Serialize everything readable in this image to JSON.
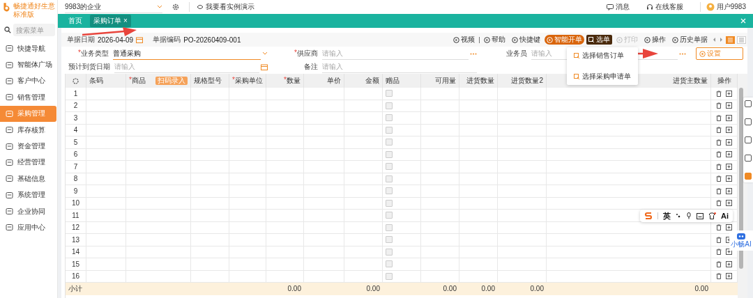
{
  "sidebar": {
    "brand": "畅捷通好生意",
    "edition": "标准版",
    "search_placeholder": "搜索菜单",
    "items": [
      {
        "label": "快捷导航",
        "selected": false
      },
      {
        "label": "智能体广场",
        "selected": false
      },
      {
        "label": "客户中心",
        "selected": false
      },
      {
        "label": "销售管理",
        "selected": false
      },
      {
        "label": "采购管理",
        "selected": true
      },
      {
        "label": "库存核算",
        "selected": false
      },
      {
        "label": "资金管理",
        "selected": false
      },
      {
        "label": "经营管理",
        "selected": false
      },
      {
        "label": "基础信息",
        "selected": false
      },
      {
        "label": "系统管理",
        "selected": false
      },
      {
        "label": "企业协同",
        "selected": false
      },
      {
        "label": "应用中心",
        "selected": false
      }
    ]
  },
  "top_bar": {
    "company": "9983的企业",
    "demo_link": "我要看实例演示",
    "messages": "消息",
    "support": "在线客服",
    "user": "用户9983"
  },
  "tabs": [
    {
      "label": "首页",
      "selected": false
    },
    {
      "label": "采购订单",
      "selected": true,
      "close": "×"
    }
  ],
  "document": {
    "date_label": "单据日期",
    "date": "2026-04-09",
    "code_label": "单据编码",
    "code": "PO-20260409-001"
  },
  "toolbar": [
    {
      "label": "视频",
      "kind": "link",
      "disabled": false
    },
    {
      "label": "帮助",
      "kind": "link",
      "disabled": false
    },
    {
      "label": "快捷键",
      "kind": "link",
      "disabled": false
    },
    {
      "label": "智能开单",
      "kind": "primary",
      "disabled": false
    },
    {
      "label": "选单",
      "kind": "menu",
      "disabled": false
    },
    {
      "label": "打印",
      "kind": "link",
      "disabled": true
    },
    {
      "label": "操作",
      "kind": "link",
      "disabled": false
    },
    {
      "label": "历史单据",
      "kind": "link",
      "disabled": false
    }
  ],
  "select_menu": [
    "选择销售订单",
    "选择采购申请单"
  ],
  "form": {
    "fields": [
      {
        "label": "业务类型",
        "required": true,
        "value": "普通采购",
        "kind": "select"
      },
      {
        "label": "供应商",
        "required": true,
        "placeholder": "请输入",
        "kind": "lookup"
      },
      {
        "label": "业务员",
        "required": false,
        "placeholder": "请输入",
        "kind": "lookup"
      },
      {
        "label": "预计到货日期",
        "required": false,
        "placeholder": "请输入",
        "kind": "date"
      },
      {
        "label": "备注",
        "required": false,
        "placeholder": "请输入",
        "kind": "text"
      }
    ],
    "settings_button": "设置"
  },
  "required_mark": "*",
  "table": {
    "columns": [
      {
        "label": "条码",
        "kind": "text",
        "required": false
      },
      {
        "label": "商品",
        "kind": "text",
        "required": true,
        "badge": "扫码录入"
      },
      {
        "label": "规格型号",
        "kind": "text",
        "required": false
      },
      {
        "label": "采购单位",
        "kind": "text",
        "required": true
      },
      {
        "label": "数量",
        "kind": "number",
        "required": true,
        "total": "0.00"
      },
      {
        "label": "单价",
        "kind": "number",
        "required": false
      },
      {
        "label": "金额",
        "kind": "number",
        "required": false,
        "total": "0.00"
      },
      {
        "label": "赠品",
        "kind": "checkbox",
        "required": false
      },
      {
        "label": "可用量",
        "kind": "number",
        "required": false,
        "total": "0.00"
      },
      {
        "label": "进货数量",
        "kind": "number",
        "required": false,
        "total": "0.00"
      },
      {
        "label": "进货数量2",
        "kind": "number",
        "required": false,
        "total": "0.00"
      },
      {
        "label": "进货主数量",
        "kind": "number",
        "required": false,
        "total": "0.00"
      },
      {
        "label": "操作",
        "kind": "actions",
        "required": false
      }
    ],
    "rows": [
      {
        "no": "1",
        "gift_checked": false
      },
      {
        "no": "2",
        "gift_checked": false
      },
      {
        "no": "3",
        "gift_checked": false
      },
      {
        "no": "4",
        "gift_checked": false
      },
      {
        "no": "5",
        "gift_checked": false
      },
      {
        "no": "6",
        "gift_checked": false
      },
      {
        "no": "7",
        "gift_checked": false
      },
      {
        "no": "8",
        "gift_checked": false
      },
      {
        "no": "9",
        "gift_checked": false
      },
      {
        "no": "10",
        "gift_checked": false
      },
      {
        "no": "11",
        "gift_checked": false
      },
      {
        "no": "12",
        "gift_checked": false
      },
      {
        "no": "13",
        "gift_checked": false
      },
      {
        "no": "14",
        "gift_checked": false
      },
      {
        "no": "15",
        "gift_checked": false
      },
      {
        "no": "16",
        "gift_checked": false
      }
    ],
    "subtotal_label": "小计"
  },
  "ime_toolbar": {
    "language": "英",
    "ai": "Ai"
  },
  "assistant": {
    "label": "小畅AI"
  }
}
